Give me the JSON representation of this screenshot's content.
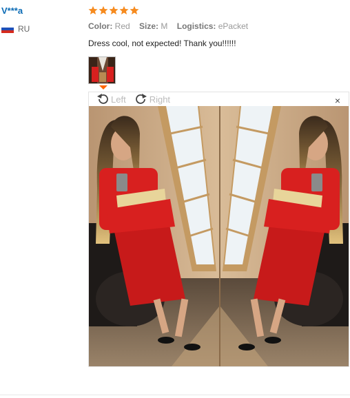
{
  "reviewer": {
    "name": "V***a",
    "country_code": "RU",
    "flag_colors": [
      "#ffffff",
      "#1e4fb8",
      "#d52b1e"
    ]
  },
  "review": {
    "rating": 5,
    "rating_max": 5,
    "star_color": "#f68b1f",
    "color_label": "Color:",
    "color_value": "Red",
    "size_label": "Size:",
    "size_value": "M",
    "logistics_label": "Logistics:",
    "logistics_value": "ePacket",
    "text": "Dress cool, not expected! Thank you!!!!!!"
  },
  "viewer": {
    "rotate_left_label": "Left",
    "rotate_right_label": "Right",
    "close_symbol": "×"
  },
  "colors": {
    "link": "#0b6bb5",
    "accent": "#ff6600",
    "dress": "#d8201f"
  }
}
